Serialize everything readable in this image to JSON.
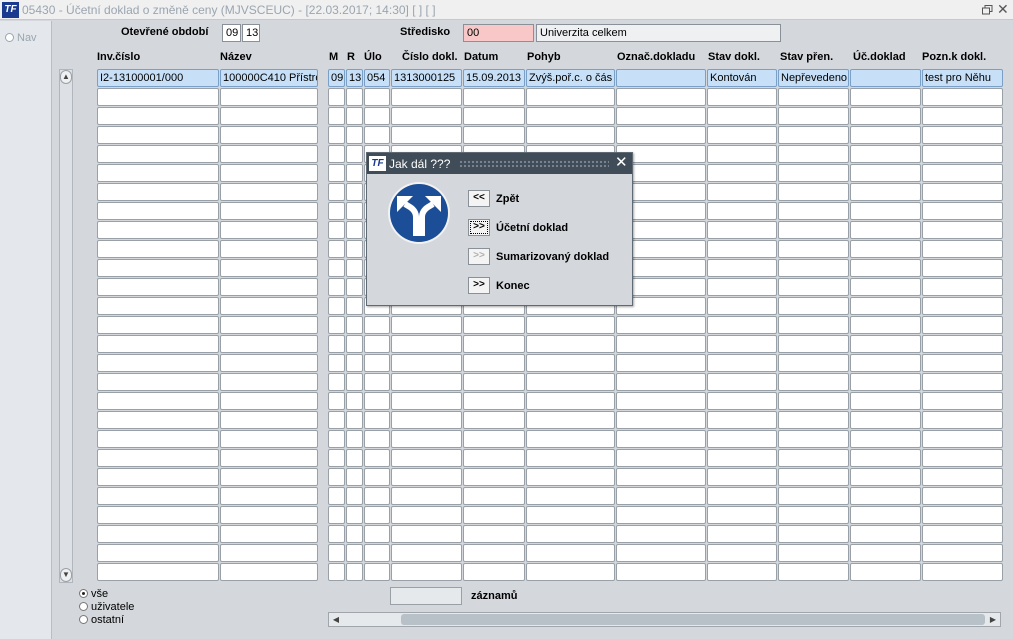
{
  "window": {
    "logo": "TF",
    "title": "05430 - Účetní doklad o změně ceny (MJVSCEUC) - [22.03.2017; 14:30]  [ ]  [ ]"
  },
  "nav": {
    "label": "Nav"
  },
  "header": {
    "period_label": "Otevřené období",
    "period_month": "09",
    "period_year": "13",
    "center_label": "Středisko",
    "center_code": "00",
    "center_name": "Univerzita celkem"
  },
  "table": {
    "columns": [
      "Inv.číslo",
      "Název",
      "M",
      "R",
      "Úlo",
      "Číslo dokl.",
      "Datum",
      "Pohyb",
      "Označ.dokladu",
      "Stav dokl.",
      "Stav přen.",
      "Úč.doklad",
      "Pozn.k dokl."
    ],
    "row": [
      "I2-13100001/000",
      "100000C410 Přístro",
      "09",
      "13",
      "054",
      "1313000125",
      "15.09.2013",
      "Zvýš.poř.c. o čás",
      "",
      "Kontován",
      "Nepřevedeno",
      "",
      "test pro Něhu"
    ]
  },
  "filters": {
    "options": [
      "vše",
      "uživatele",
      "ostatní"
    ],
    "selected": "vše"
  },
  "records_label": "záznamů",
  "dialog": {
    "title": "Jak dál ???",
    "options": [
      {
        "button": "<<",
        "label": "Zpět",
        "state": "normal"
      },
      {
        "button": ">>",
        "label": "Účetní doklad",
        "state": "focused"
      },
      {
        "button": ">>",
        "label": "Sumarizovaný doklad",
        "state": "disabled"
      },
      {
        "button": ">>",
        "label": "Konec",
        "state": "normal"
      }
    ]
  },
  "colors": {
    "accent": "#1a3a8f",
    "selected_row": "#c7e0f8",
    "required_field": "#f8c8c8",
    "dialog_title": "#404c58"
  }
}
